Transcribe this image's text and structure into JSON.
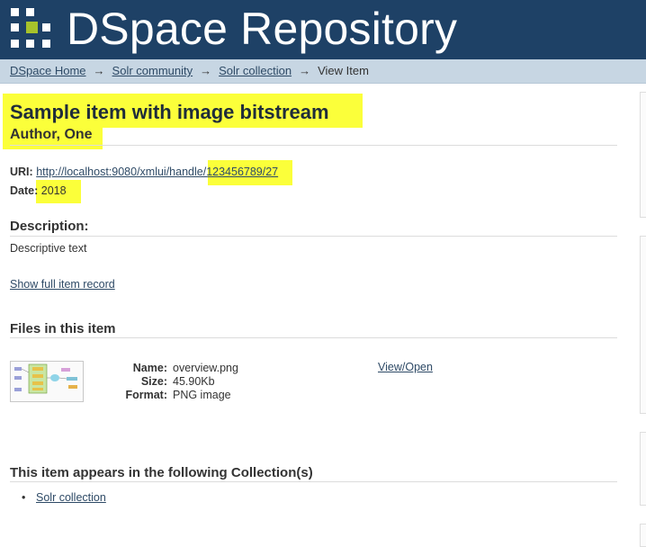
{
  "header": {
    "site_title": "DSpace Repository"
  },
  "breadcrumb": {
    "items": [
      "DSpace Home",
      "Solr community",
      "Solr collection"
    ],
    "current": "View Item",
    "separator": "→"
  },
  "item": {
    "title": "Sample item with image bitstream",
    "author": "Author, One",
    "uri_label": "URI:",
    "uri_value": "http://localhost:9080/xmlui/handle/123456789/27",
    "date_label": "Date:",
    "date_value": "2018",
    "description_heading": "Description:",
    "description_text": "Descriptive text",
    "full_record_link": "Show full item record"
  },
  "files": {
    "heading": "Files in this item",
    "name_label": "Name:",
    "size_label": "Size:",
    "format_label": "Format:",
    "name": "overview.png",
    "size": "45.90Kb",
    "format": "PNG image",
    "view_link": "View/Open"
  },
  "collections": {
    "heading": "This item appears in the following Collection(s)",
    "items": [
      "Solr collection"
    ]
  },
  "colors": {
    "header_bg": "#1e4166",
    "breadcrumb_bg": "#c7d6e3",
    "highlight": "#fbff3a",
    "link": "#2e4a66",
    "logo_accent": "#a7c22b"
  }
}
